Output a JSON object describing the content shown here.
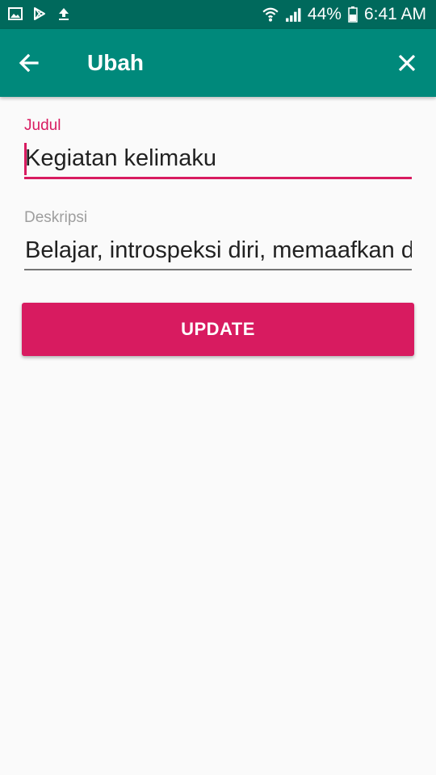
{
  "status_bar": {
    "battery": "44%",
    "time": "6:41 AM",
    "icons": [
      "image-icon",
      "play-store-icon",
      "upload-icon",
      "wifi-icon",
      "signal-icon",
      "battery-icon"
    ]
  },
  "app_bar": {
    "title": "Ubah",
    "back_icon": "arrow-back-icon",
    "close_icon": "close-icon"
  },
  "form": {
    "title_field": {
      "label": "Judul",
      "value": "Kegiatan kelimaku"
    },
    "description_field": {
      "label": "Deskripsi",
      "value": "Belajar, introspeksi diri, memaafkan d"
    },
    "update_label": "UPDATE"
  },
  "colors": {
    "status_bar": "#00695c",
    "app_bar": "#00897b",
    "accent": "#d81b60",
    "background": "#fafafa"
  }
}
